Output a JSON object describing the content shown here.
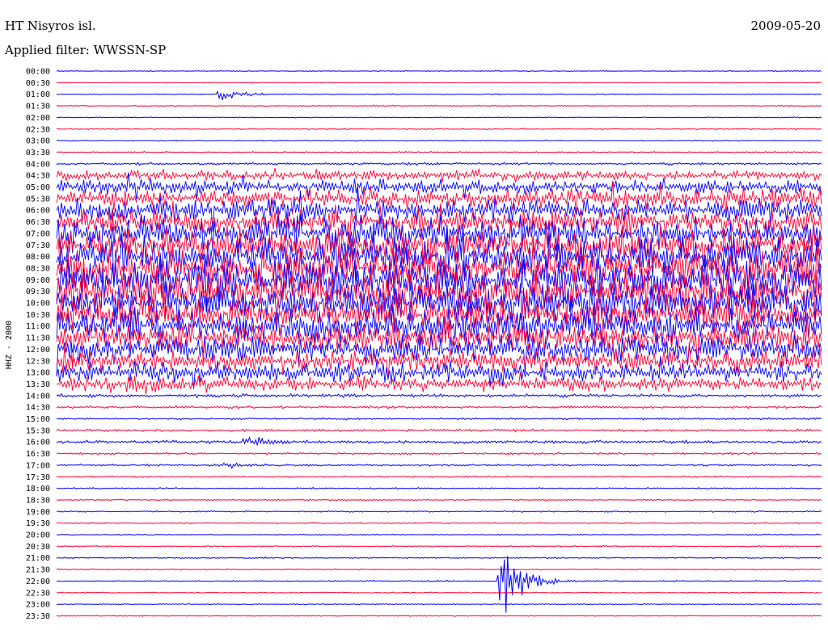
{
  "header": {
    "station": "HT Nisyros isl.",
    "date": "2009-05-20",
    "filter": "Applied filter: WWSSN-SP"
  },
  "chart_data": {
    "type": "line",
    "title": "HT Nisyros isl.",
    "date": "2009-05-20",
    "filter": "WWSSN-SP",
    "ylabel": "HHZ - 2000",
    "trace_colors": [
      "#0000ff",
      "#ff0033"
    ],
    "rows": [
      {
        "time": "00:00",
        "amp": 0.6
      },
      {
        "time": "00:30",
        "amp": 0.5
      },
      {
        "time": "01:00",
        "amp": 0.6
      },
      {
        "time": "01:30",
        "amp": 0.7
      },
      {
        "time": "02:00",
        "amp": 0.6
      },
      {
        "time": "02:30",
        "amp": 0.8
      },
      {
        "time": "03:00",
        "amp": 0.7
      },
      {
        "time": "03:30",
        "amp": 0.8
      },
      {
        "time": "04:00",
        "amp": 1.5
      },
      {
        "time": "04:30",
        "amp": 6
      },
      {
        "time": "05:00",
        "amp": 9
      },
      {
        "time": "05:30",
        "amp": 12
      },
      {
        "time": "06:00",
        "amp": 14
      },
      {
        "time": "06:30",
        "amp": 16
      },
      {
        "time": "07:00",
        "amp": 20
      },
      {
        "time": "07:30",
        "amp": 22
      },
      {
        "time": "08:00",
        "amp": 24
      },
      {
        "time": "08:30",
        "amp": 25
      },
      {
        "time": "09:00",
        "amp": 25
      },
      {
        "time": "09:30",
        "amp": 25
      },
      {
        "time": "10:00",
        "amp": 24
      },
      {
        "time": "10:30",
        "amp": 23
      },
      {
        "time": "11:00",
        "amp": 20
      },
      {
        "time": "11:30",
        "amp": 18
      },
      {
        "time": "12:00",
        "amp": 16
      },
      {
        "time": "12:30",
        "amp": 14
      },
      {
        "time": "13:00",
        "amp": 12
      },
      {
        "time": "13:30",
        "amp": 9
      },
      {
        "time": "14:00",
        "amp": 2
      },
      {
        "time": "14:30",
        "amp": 1.5
      },
      {
        "time": "15:00",
        "amp": 1.2
      },
      {
        "time": "15:30",
        "amp": 1.5
      },
      {
        "time": "16:00",
        "amp": 1.8
      },
      {
        "time": "16:30",
        "amp": 1.3
      },
      {
        "time": "17:00",
        "amp": 1.2
      },
      {
        "time": "17:30",
        "amp": 1.0
      },
      {
        "time": "18:00",
        "amp": 0.9
      },
      {
        "time": "18:30",
        "amp": 0.8
      },
      {
        "time": "19:00",
        "amp": 0.9
      },
      {
        "time": "19:30",
        "amp": 0.9
      },
      {
        "time": "20:00",
        "amp": 0.8
      },
      {
        "time": "20:30",
        "amp": 0.8
      },
      {
        "time": "21:00",
        "amp": 0.8
      },
      {
        "time": "21:30",
        "amp": 0.8
      },
      {
        "time": "22:00",
        "amp": 0.8
      },
      {
        "time": "22:30",
        "amp": 0.7
      },
      {
        "time": "23:00",
        "amp": 0.7
      },
      {
        "time": "23:30",
        "amp": 0.7
      }
    ],
    "events": [
      {
        "time": "01:00",
        "minute": 6.5,
        "amp": 6
      },
      {
        "time": "16:00",
        "minute": 7.5,
        "amp": 6
      },
      {
        "time": "17:00",
        "minute": 6.5,
        "amp": 4
      },
      {
        "time": "22:00",
        "minute": 17.5,
        "amp": 40
      }
    ]
  }
}
